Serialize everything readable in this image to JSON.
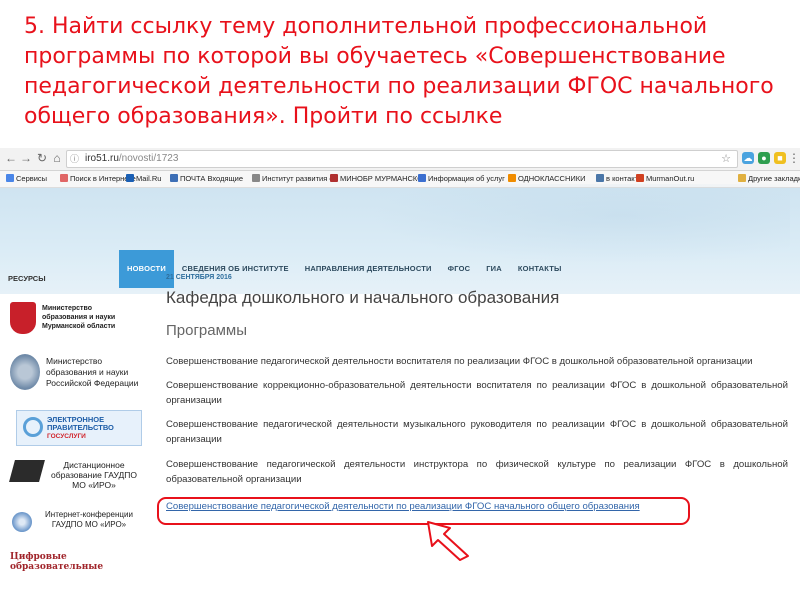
{
  "slide": {
    "instruction": "5. Найти ссылку тему дополнительной профессиональной программы  по которой вы обучаетесь «Совершенствование педагогической деятельности по реализации ФГОС начального общего образования». Пройти по ссылке"
  },
  "browser": {
    "url_host": "iro51.ru",
    "url_path": "/novosti/1723",
    "bookmarks": [
      {
        "label": "Сервисы",
        "color": "#4a86e8"
      },
      {
        "label": "Поиск в Интернете",
        "color": "#e06666"
      },
      {
        "label": "Mail.Ru",
        "color": "#1a5fb4"
      },
      {
        "label": "ПОЧТА Входящие",
        "color": "#3d6fb6"
      },
      {
        "label": "Институт развития об",
        "color": "#888888"
      },
      {
        "label": "МИНОБР МУРМАНСКО",
        "color": "#b03030"
      },
      {
        "label": "Информация об услуг",
        "color": "#3b6fd0"
      },
      {
        "label": "ОДНОКЛАССНИКИ",
        "color": "#f08c00"
      },
      {
        "label": "в контакте",
        "color": "#4a76a8"
      },
      {
        "label": "MurmanOut.ru",
        "color": "#d04020"
      },
      {
        "label": "Другие закладк",
        "color": "#e0b040"
      }
    ]
  },
  "site": {
    "menu": [
      {
        "label": "НОВОСТИ",
        "active": true
      },
      {
        "label": "СВЕДЕНИЯ ОБ ИНСТИТУТЕ",
        "active": false
      },
      {
        "label": "НАПРАВЛЕНИЯ ДЕЯТЕЛЬНОСТИ",
        "active": false
      },
      {
        "label": "ФГОС",
        "active": false
      },
      {
        "label": "ГИА",
        "active": false
      },
      {
        "label": "КОНТАКТЫ",
        "active": false
      }
    ],
    "sidebar": {
      "title": "РЕСУРСЫ",
      "banner1": "Министерство образования и науки Мурманской области",
      "banner2": "Министерство образования и науки Российской Федерации",
      "banner3_line1": "ЭЛЕКТРОННОЕ",
      "banner3_line2": "ПРАВИТЕЛЬСТВО",
      "banner3_line3": "ГОСУСЛУГИ",
      "banner4": "Дистанционное образование ГАУДПО МО «ИРО»",
      "banner5": "Интернет-конференции ГАУДПО МО «ИРО»",
      "banner6": "Цифровые образовательные"
    },
    "date": "21 СЕНТЯБРЯ 2016",
    "heading": "Кафедра дошкольного и начального образования",
    "subheading": "Программы",
    "programs": [
      "Совершенствование педагогической деятельности воспитателя по реализации ФГОС в дошкольной образовательной организации",
      "Совершенствование коррекционно-образовательной деятельности воспитателя по реализации ФГОС в дошкольной образовательной организации",
      "Совершенствование педагогической деятельности музыкального руководителя по реализации ФГОС в дошкольной образовательной организации",
      "Совершенствование педагогической деятельности инструктора по физической культуре по реализации ФГОС в дошкольной образовательной организации",
      "Совершенствование педагогической деятельности по реализации ФГОС начального общего образования"
    ]
  },
  "colors": {
    "instruction": "#e8111b",
    "menu_active": "#3c9ad8",
    "link": "#3366aa"
  }
}
